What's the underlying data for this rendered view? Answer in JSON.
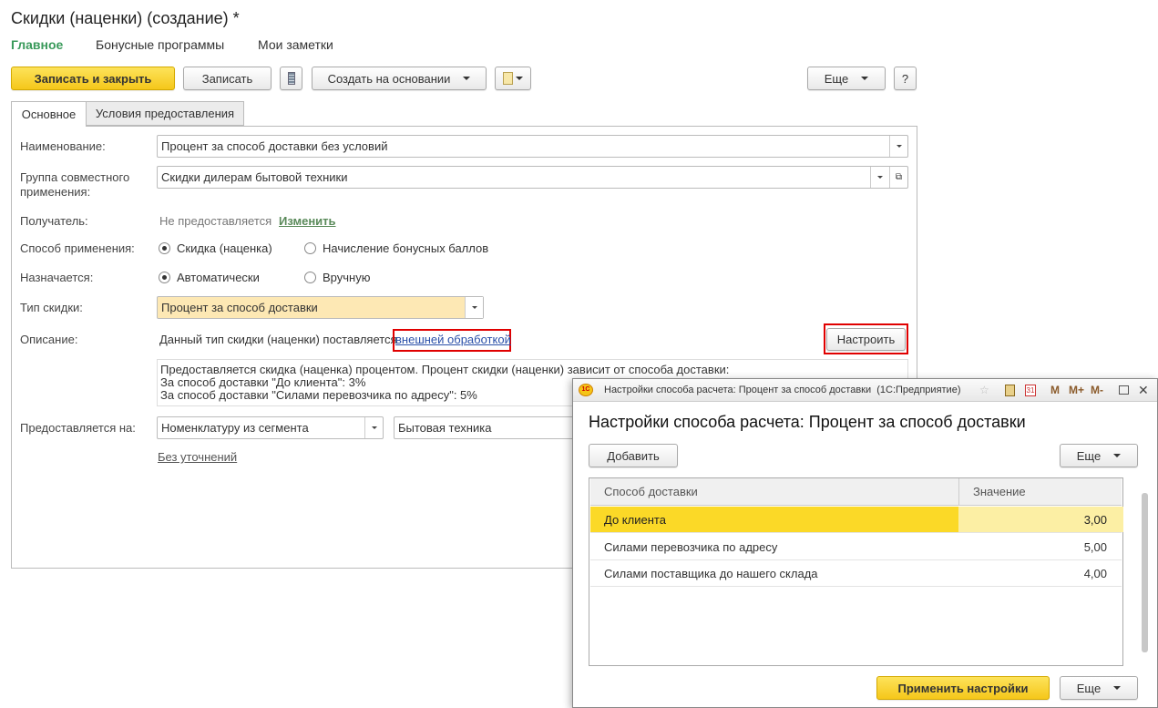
{
  "title": "Скидки (наценки) (создание) *",
  "nav": [
    "Главное",
    "Бонусные программы",
    "Мои заметки"
  ],
  "toolbar": {
    "save_close": "Записать и закрыть",
    "save": "Записать",
    "create_based": "Создать на основании",
    "more": "Еще",
    "help": "?"
  },
  "tabs": [
    "Основное",
    "Условия предоставления"
  ],
  "form": {
    "name_label": "Наименование:",
    "name_value": "Процент за способ доставки без условий",
    "group_label": "Группа совместного применения:",
    "group_value": "Скидки дилерам бытовой техники",
    "recipient_label": "Получатель:",
    "recipient_value": "Не предоставляется",
    "recipient_change": "Изменить",
    "method_label": "Способ применения:",
    "method_opt1": "Скидка (наценка)",
    "method_opt2": "Начисление бонусных баллов",
    "assign_label": "Назначается:",
    "assign_opt1": "Автоматически",
    "assign_opt2": "Вручную",
    "type_label": "Тип скидки:",
    "type_value": "Процент за способ доставки",
    "desc_label": "Описание:",
    "desc_text": "Данный тип скидки (наценки) поставляется",
    "desc_link": "внешней обработкой",
    "configure": "Настроить",
    "desc_lines": [
      "Предоставляется скидка (наценка) процентом. Процент скидки (наценки) зависит от способа доставки:",
      "За способ доставки \"До клиента\": 3%",
      "За способ доставки \"Силами перевозчика по адресу\": 5%"
    ],
    "applies_label": "Предоставляется на:",
    "applies_value1": "Номенклатуру из сегмента",
    "applies_value2": "Бытовая техника",
    "no_details": "Без уточнений"
  },
  "dialog": {
    "window_title": "Настройки способа расчета: Процент за способ доставки  (1С:Предприятие)",
    "title_buttons": [
      "M",
      "M+",
      "M-"
    ],
    "heading": "Настройки способа расчета: Процент за способ доставки",
    "add": "Добавить",
    "more": "Еще",
    "columns": [
      "Способ доставки",
      "Значение"
    ],
    "rows": [
      {
        "method": "До клиента",
        "value": "3,00"
      },
      {
        "method": "Силами перевозчика по адресу",
        "value": "5,00"
      },
      {
        "method": "Силами поставщика до нашего склада",
        "value": "4,00"
      }
    ],
    "apply": "Применить настройки"
  }
}
